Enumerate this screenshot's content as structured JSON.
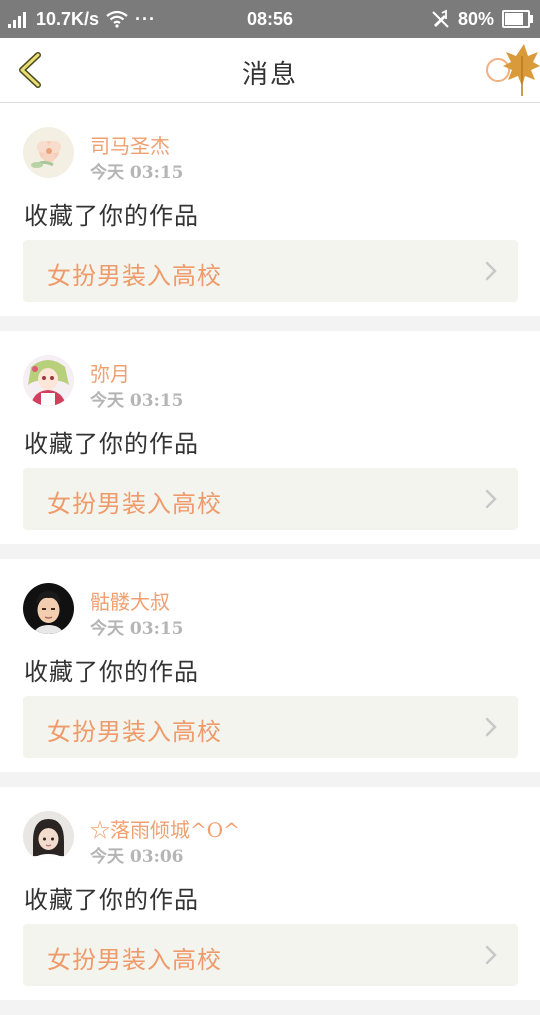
{
  "status_bar": {
    "network_speed": "10.7K/s",
    "more": "···",
    "time": "08:56",
    "battery_text": "80%",
    "battery_level": 0.8
  },
  "nav": {
    "title": "消息"
  },
  "colors": {
    "accent": "#ef9a6a",
    "username": "#f0a070",
    "box_bg": "#f4f4ee",
    "status_bar_bg": "#7b7b7b"
  },
  "messages": [
    {
      "username": "司马圣杰",
      "day": "今天",
      "time": "03:15",
      "action": "收藏了你的作品",
      "work_title": "女扮男装入高校"
    },
    {
      "username": "弥月",
      "day": "今天",
      "time": "03:15",
      "action": "收藏了你的作品",
      "work_title": "女扮男装入高校"
    },
    {
      "username": "骷髅大叔",
      "day": "今天",
      "time": "03:15",
      "action": "收藏了你的作品",
      "work_title": "女扮男装入高校"
    },
    {
      "username": "☆落雨倾城^O^",
      "day": "今天",
      "time": "03:06",
      "action": "收藏了你的作品",
      "work_title": "女扮男装入高校"
    }
  ]
}
